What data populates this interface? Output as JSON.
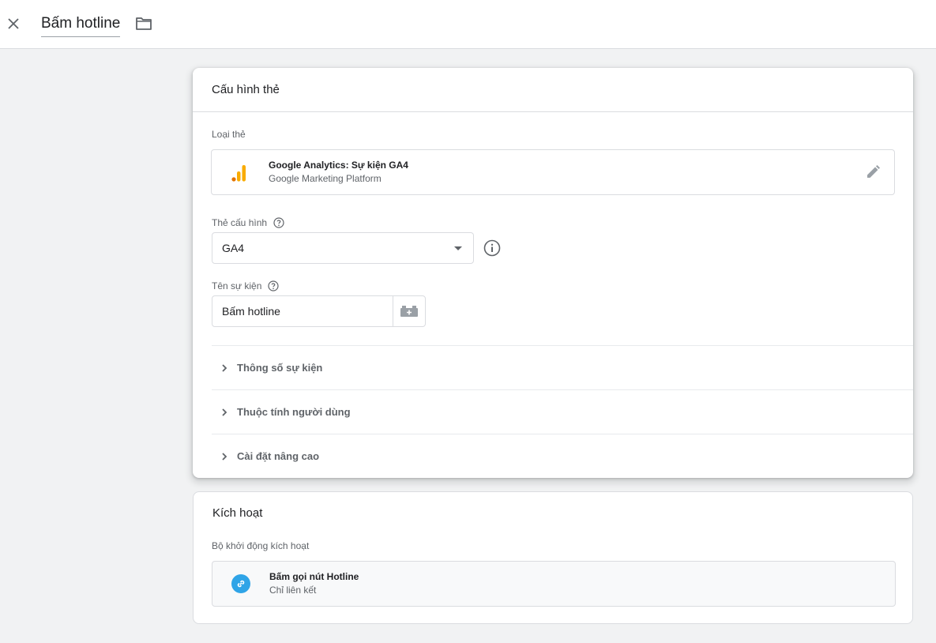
{
  "header": {
    "title": "Bấm hotline",
    "close_icon": "close-icon",
    "folder_icon": "folder-icon"
  },
  "config": {
    "title": "Cấu hình thẻ",
    "tag_type_label": "Loại thẻ",
    "tag_type": {
      "name": "Google Analytics: Sự kiện GA4",
      "provider": "Google Marketing Platform",
      "icon": "analytics-icon"
    },
    "config_tag_label": "Thẻ cấu hình",
    "config_tag_value": "GA4",
    "event_name_label": "Tên sự kiện",
    "event_name_value": "Bấm hotline",
    "sections": [
      {
        "label": "Thông số sự kiện"
      },
      {
        "label": "Thuộc tính người dùng"
      },
      {
        "label": "Cài đặt nâng cao"
      }
    ]
  },
  "trigger": {
    "title": "Kích hoạt",
    "firing_label": "Bộ khởi động kích hoạt",
    "item": {
      "name": "Bấm gọi nút Hotline",
      "type": "Chỉ liên kết",
      "icon": "link-icon"
    }
  },
  "colors": {
    "accent_orange": "#f9ab00",
    "accent_orange_dark": "#e37400",
    "link_blue": "#2fa4e7"
  }
}
